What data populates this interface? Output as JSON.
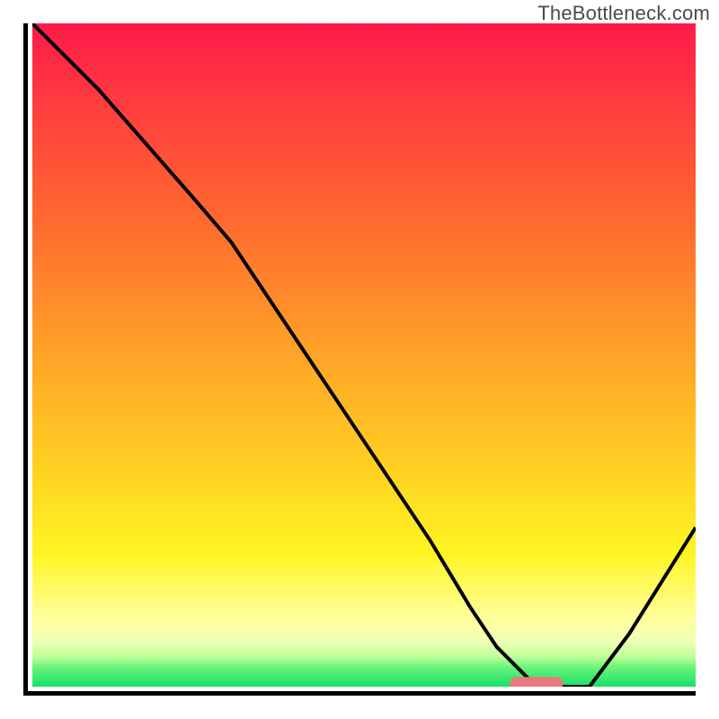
{
  "watermark": "TheBottleneck.com",
  "chart_data": {
    "type": "line",
    "title": "",
    "xlabel": "",
    "ylabel": "",
    "xlim": [
      0,
      100
    ],
    "ylim": [
      0,
      100
    ],
    "grid": false,
    "legend": false,
    "series": [
      {
        "name": "bottleneck-curve",
        "x": [
          0,
          10,
          24,
          30,
          40,
          50,
          60,
          66,
          70,
          76,
          80,
          84,
          90,
          95,
          100
        ],
        "y": [
          100,
          90,
          74,
          67,
          52,
          37,
          22,
          12,
          6,
          0,
          0,
          0,
          8,
          16,
          24
        ]
      }
    ],
    "marker": {
      "name": "optimal-range",
      "x_start": 72,
      "x_end": 80,
      "y": 0.5,
      "color": "#e87a7d"
    }
  },
  "colors": {
    "axis": "#000000",
    "curve": "#000000",
    "marker": "#e87a7d",
    "gradient_top": "#ff1a49",
    "gradient_bottom": "#16e06a"
  }
}
